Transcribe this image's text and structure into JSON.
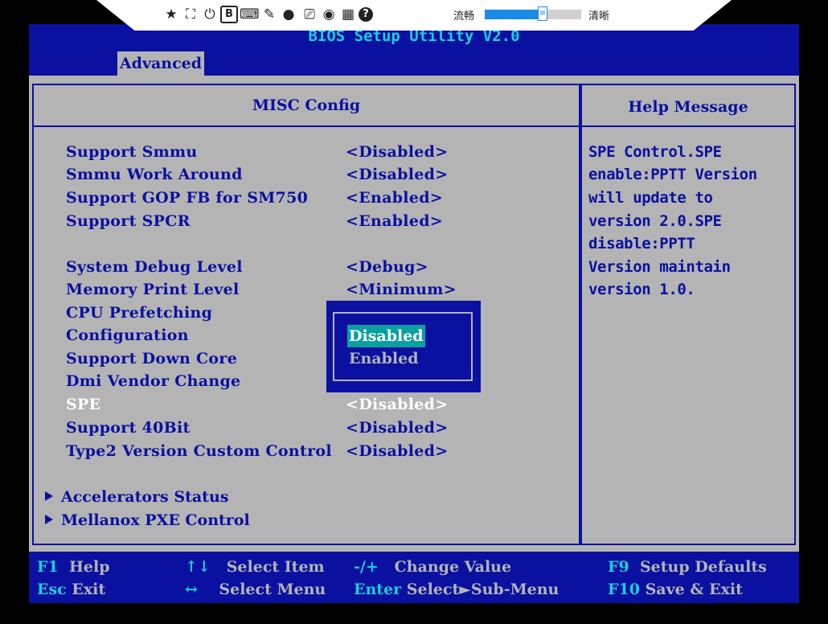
{
  "toolbar": {
    "icons": [
      "pin-icon",
      "fit-screen-icon",
      "power-icon",
      "b-box-icon",
      "keyboard-icon",
      "mouse-icon",
      "record-icon",
      "save-icon",
      "snapshot-icon",
      "calculator-icon",
      "help-icon"
    ],
    "glyphs": [
      "★",
      "⛶",
      "⏻",
      "B",
      "⌨",
      "✎",
      "●",
      "⎚",
      "◉",
      "▦",
      "?"
    ],
    "quality_left": "流畅",
    "quality_right": "清晰",
    "quality_level": 0.6,
    "slider_thumb": "≡"
  },
  "bios": {
    "title": "BIOS Setup Utility V2.0",
    "tab": "Advanced",
    "panel_title": "MISC Config",
    "help_title": "Help Message",
    "items": [
      {
        "label": "Support Smmu",
        "value": "<Disabled>"
      },
      {
        "label": "Smmu Work Around",
        "value": "<Disabled>"
      },
      {
        "label": "Support GOP FB for SM750",
        "value": "<Enabled>"
      },
      {
        "label": "Support SPCR",
        "value": "<Enabled>"
      },
      {
        "label": "System Debug Level",
        "value": "<Debug>"
      },
      {
        "label": "Memory Print Level",
        "value": "<Minimum>"
      },
      {
        "label": "CPU Prefetching",
        "value": ""
      },
      {
        "label": "Configuration",
        "value": ""
      },
      {
        "label": "Support Down Core",
        "value": ""
      },
      {
        "label": "Dmi Vendor Change",
        "value": ""
      },
      {
        "label": "SPE",
        "value": "<Disabled>"
      },
      {
        "label": "Support 40Bit",
        "value": "<Disabled>"
      },
      {
        "label": "Type2 Version Custom Control",
        "value": "<Disabled>"
      }
    ],
    "submenus": [
      "Accelerators Status",
      "Mellanox PXE Control"
    ],
    "help_lines": [
      "SPE Control.SPE",
      "enable:PPTT Version",
      "will update to",
      "version 2.0.SPE",
      "disable:PPTT",
      "Version maintain",
      "version 1.0."
    ],
    "popup_options": [
      "Disabled",
      "Enabled"
    ],
    "footer": [
      {
        "key": "F1",
        "desc": "Help"
      },
      {
        "key": "Esc",
        "desc": "Exit"
      },
      {
        "key": "↑↓",
        "desc": "Select Item"
      },
      {
        "key": "↔",
        "desc": "Select Menu"
      },
      {
        "key": "-/+",
        "desc": "Change Value"
      },
      {
        "key": "Enter",
        "desc": "Select►Sub-Menu"
      },
      {
        "key": "F9",
        "desc": "Setup Defaults"
      },
      {
        "key": "F10",
        "desc": "Save & Exit"
      }
    ]
  }
}
